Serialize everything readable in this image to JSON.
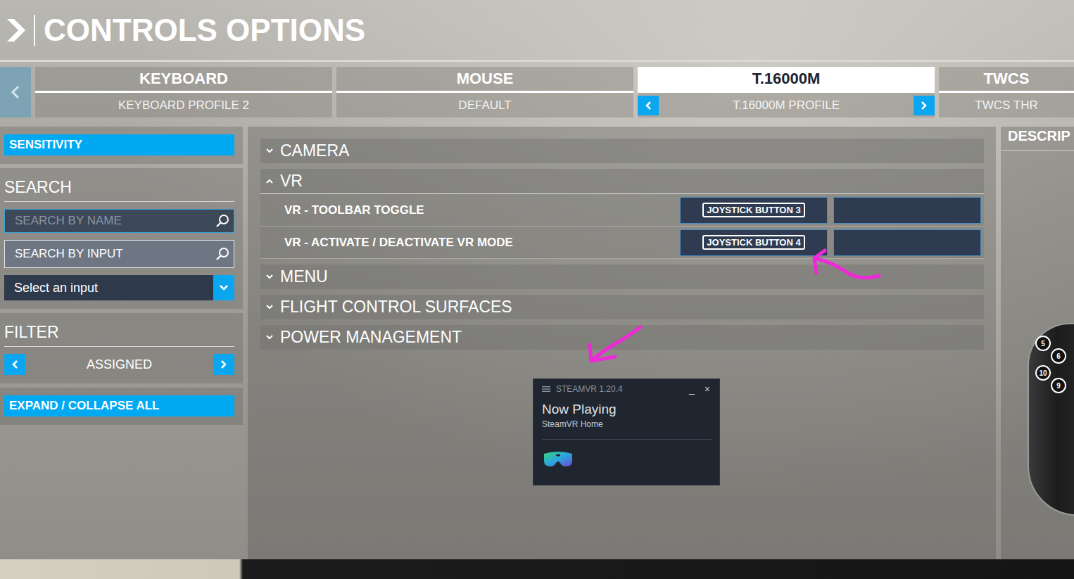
{
  "header": {
    "title": "CONTROLS OPTIONS"
  },
  "devices": [
    {
      "name": "KEYBOARD",
      "profile": "KEYBOARD PROFILE 2",
      "selected": false
    },
    {
      "name": "MOUSE",
      "profile": "DEFAULT",
      "selected": false
    },
    {
      "name": "T.16000M",
      "profile": "T.16000M PROFILE",
      "selected": true
    },
    {
      "name": "TWCS",
      "profile": "TWCS THR",
      "selected": false
    }
  ],
  "sidebar": {
    "sensitivity": "SENSITIVITY",
    "search_title": "SEARCH",
    "search_by_name": {
      "placeholder": "SEARCH BY NAME"
    },
    "search_by_input": "SEARCH BY INPUT",
    "input_select": "Select an input",
    "filter_title": "FILTER",
    "filter_value": "ASSIGNED",
    "expand_all": "EXPAND / COLLAPSE ALL"
  },
  "categories": [
    {
      "name": "CAMERA",
      "expanded": false,
      "bindings": []
    },
    {
      "name": "VR",
      "expanded": true,
      "bindings": [
        {
          "action": "VR - TOOLBAR TOGGLE",
          "primary": "JOYSTICK BUTTON 3",
          "secondary": ""
        },
        {
          "action": "VR - ACTIVATE / DEACTIVATE VR MODE",
          "primary": "JOYSTICK BUTTON 4",
          "secondary": ""
        }
      ]
    },
    {
      "name": "MENU",
      "expanded": false,
      "bindings": []
    },
    {
      "name": "FLIGHT CONTROL SURFACES",
      "expanded": false,
      "bindings": []
    },
    {
      "name": "POWER MANAGEMENT",
      "expanded": false,
      "bindings": []
    }
  ],
  "description": {
    "title": "DESCRIP",
    "joystick_buttons": [
      "5",
      "6",
      "10",
      "9"
    ]
  },
  "popup": {
    "title": "STEAMVR 1.20.4",
    "heading": "Now Playing",
    "subtitle": "SteamVR Home",
    "minimize": "_",
    "close": "×"
  }
}
